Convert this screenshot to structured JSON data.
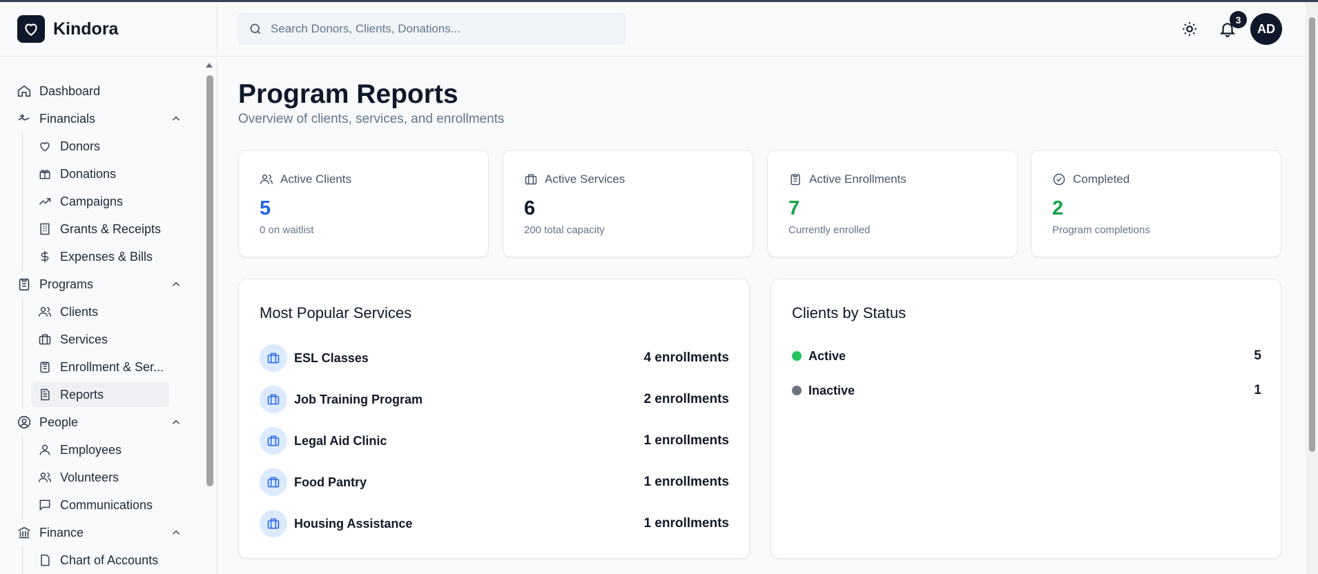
{
  "app": {
    "name": "Kindora"
  },
  "search": {
    "placeholder": "Search Donors, Clients, Donations..."
  },
  "header": {
    "notification_count": "3",
    "avatar_initials": "AD"
  },
  "sidebar": {
    "dashboard": "Dashboard",
    "financials": {
      "label": "Financials",
      "items": [
        "Donors",
        "Donations",
        "Campaigns",
        "Grants & Receipts",
        "Expenses & Bills"
      ]
    },
    "programs": {
      "label": "Programs",
      "items": [
        "Clients",
        "Services",
        "Enrollment & Ser...",
        "Reports"
      ]
    },
    "people": {
      "label": "People",
      "items": [
        "Employees",
        "Volunteers",
        "Communications"
      ]
    },
    "finance": {
      "label": "Finance",
      "items": [
        "Chart of Accounts"
      ]
    }
  },
  "page": {
    "title": "Program Reports",
    "subtitle": "Overview of clients, services, and enrollments"
  },
  "stats": [
    {
      "label": "Active Clients",
      "value": "5",
      "note": "0 on waitlist",
      "color": "#2563eb"
    },
    {
      "label": "Active Services",
      "value": "6",
      "note": "200 total capacity",
      "color": "#0f172a"
    },
    {
      "label": "Active Enrollments",
      "value": "7",
      "note": "Currently enrolled",
      "color": "#16a34a"
    },
    {
      "label": "Completed",
      "value": "2",
      "note": "Program completions",
      "color": "#16a34a"
    }
  ],
  "popular_services": {
    "title": "Most Popular Services",
    "items": [
      {
        "name": "ESL Classes",
        "count": "4 enrollments"
      },
      {
        "name": "Job Training Program",
        "count": "2 enrollments"
      },
      {
        "name": "Legal Aid Clinic",
        "count": "1 enrollments"
      },
      {
        "name": "Food Pantry",
        "count": "1 enrollments"
      },
      {
        "name": "Housing Assistance",
        "count": "1 enrollments"
      }
    ]
  },
  "clients_by_status": {
    "title": "Clients by Status",
    "items": [
      {
        "name": "Active",
        "value": "5",
        "color": "#22c55e"
      },
      {
        "name": "Inactive",
        "value": "1",
        "color": "#6b7280"
      }
    ]
  }
}
